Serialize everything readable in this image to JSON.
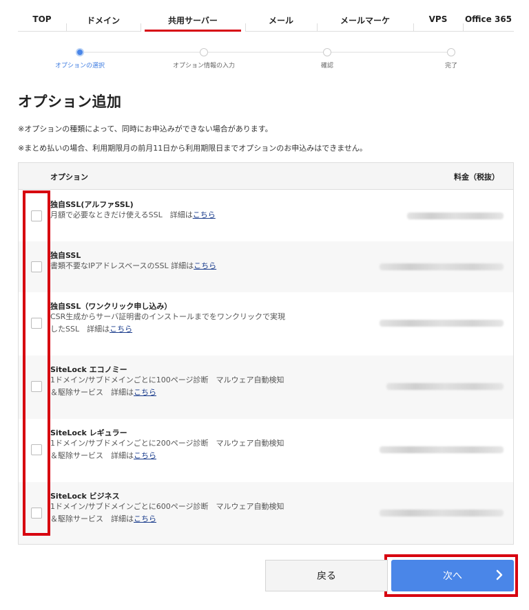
{
  "nav": {
    "tabs": [
      {
        "label": "TOP",
        "active": false
      },
      {
        "label": "ドメイン",
        "active": false
      },
      {
        "label": "共用サーバー",
        "active": true
      },
      {
        "label": "メール",
        "active": false
      },
      {
        "label": "メールマーケ",
        "active": false
      },
      {
        "label": "VPS",
        "active": false
      },
      {
        "label": "Office 365",
        "active": false
      }
    ]
  },
  "steps": [
    {
      "label": "オプションの選択",
      "active": true
    },
    {
      "label": "オプション情報の入力",
      "active": false
    },
    {
      "label": "確認",
      "active": false
    },
    {
      "label": "完了",
      "active": false
    }
  ],
  "page": {
    "title": "オプション追加",
    "note1": "※オプションの種類によって、同時にお申込みができない場合があります。",
    "note2": "※まとめ払いの場合、利用期限月の前月11日から利用期限日までオプションのお申込みはできません。"
  },
  "table": {
    "header_option": "オプション",
    "header_price": "料金（税抜）",
    "detail_link": "こちら",
    "rows": [
      {
        "title": "独自SSL(アルファSSL)",
        "desc": "月額で必要なときだけ使えるSSL　詳細は",
        "checked": false
      },
      {
        "title": "独自SSL",
        "desc": "書類不要なIPアドレスベースのSSL 詳細は",
        "checked": false
      },
      {
        "title": "独自SSL（ワンクリック申し込み）",
        "desc": "CSR生成からサーバ証明書のインストールまでをワンクリックで実現したSSL　詳細は",
        "checked": false
      },
      {
        "title": "SiteLock エコノミー",
        "desc": "1ドメイン/サブドメインごとに100ページ診断　マルウェア自動検知＆駆除サービス　詳細は",
        "checked": false
      },
      {
        "title": "SiteLock レギュラー",
        "desc": "1ドメイン/サブドメインごとに200ページ診断　マルウェア自動検知＆駆除サービス　詳細は",
        "checked": false
      },
      {
        "title": "SiteLock ビジネス",
        "desc": "1ドメイン/サブドメインごとに600ページ診断　マルウェア自動検知＆駆除サービス　詳細は",
        "checked": false
      }
    ]
  },
  "buttons": {
    "back": "戻る",
    "next": "次へ"
  },
  "colors": {
    "accent_red": "#d7000f",
    "primary_blue": "#4a86e8",
    "link": "#1a3c8c"
  },
  "icons": {
    "next": "chevron-right-icon"
  }
}
